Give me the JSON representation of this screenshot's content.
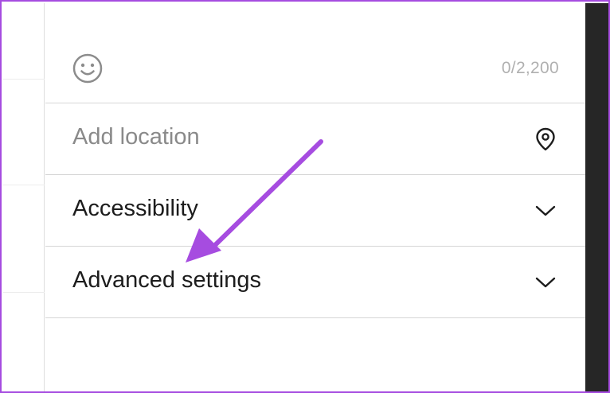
{
  "composer": {
    "emoji_icon": "smiley-icon",
    "char_count": "0/2,200"
  },
  "location": {
    "placeholder": "Add location",
    "icon": "location-pin-icon"
  },
  "accessibility": {
    "label": "Accessibility",
    "icon": "chevron-down-icon"
  },
  "advanced": {
    "label": "Advanced settings",
    "icon": "chevron-down-icon"
  },
  "annotation": {
    "arrow_color": "#a64ce0"
  },
  "colors": {
    "frame_border": "#a64ce0",
    "divider": "#d6d6d6",
    "dark_strip": "#262626"
  }
}
